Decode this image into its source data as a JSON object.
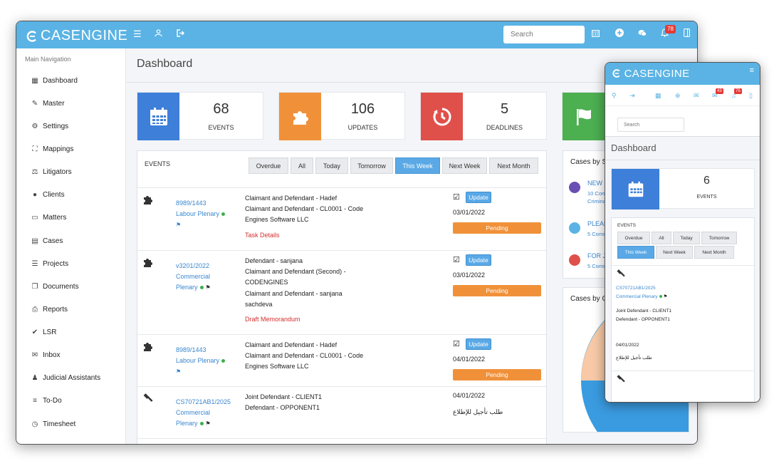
{
  "app": {
    "name": "CASENGINE"
  },
  "topbar": {
    "search_placeholder": "Search",
    "notification_count": "78"
  },
  "sidebar": {
    "heading": "Main Navigation",
    "items": [
      {
        "label": "Dashboard",
        "icon": "dashboard-icon"
      },
      {
        "label": "Master",
        "icon": "edit-icon"
      },
      {
        "label": "Settings",
        "icon": "gears-icon"
      },
      {
        "label": "Mappings",
        "icon": "sitemap-icon"
      },
      {
        "label": "Litigators",
        "icon": "scale-icon"
      },
      {
        "label": "Clients",
        "icon": "user-icon"
      },
      {
        "label": "Matters",
        "icon": "folder-icon"
      },
      {
        "label": "Cases",
        "icon": "file-icon"
      },
      {
        "label": "Projects",
        "icon": "list-icon"
      },
      {
        "label": "Documents",
        "icon": "documents-icon"
      },
      {
        "label": "Reports",
        "icon": "print-icon"
      },
      {
        "label": "LSR",
        "icon": "check-icon"
      },
      {
        "label": "Inbox",
        "icon": "envelope-icon"
      },
      {
        "label": "Judicial Assistants",
        "icon": "users-icon"
      },
      {
        "label": "To-Do",
        "icon": "todo-list-icon"
      },
      {
        "label": "Timesheet",
        "icon": "clock-icon"
      }
    ]
  },
  "main": {
    "title": "Dashboard",
    "stats": [
      {
        "value": "68",
        "label": "EVENTS",
        "color": "#3d7fd9",
        "icon": "calendar-icon"
      },
      {
        "value": "106",
        "label": "UPDATES",
        "color": "#f0913a",
        "icon": "puzzle-icon"
      },
      {
        "value": "5",
        "label": "DEADLINES",
        "color": "#e0504a",
        "icon": "timer-icon"
      },
      {
        "value": "",
        "label": "",
        "color": "#4caf50",
        "icon": "flag-icon"
      }
    ],
    "events": {
      "heading": "EVENTS",
      "filters": [
        "Overdue",
        "All",
        "Today",
        "Tomorrow",
        "This Week",
        "Next Week",
        "Next Month"
      ],
      "active_filter": "This Week",
      "rows": [
        {
          "icon": "puzzle-icon",
          "case_no": "8989/1443",
          "court": "Labour Plenary",
          "lines": [
            "Claimant and Defendant - Hadef",
            "Claimant and Defendant - CL0001 - Code",
            "Engines Software LLC"
          ],
          "task": "Task Details",
          "update_label": "Update",
          "date": "03/01/2022",
          "status": "Pending"
        },
        {
          "icon": "puzzle-icon",
          "case_no": "v3201/2022",
          "court_line1": "Commercial",
          "court_line2": "Plenary",
          "lines": [
            "Defendant - sanjana",
            "Claimant and Defendant (Second) -",
            "CODENGINES",
            "Claimant and Defendant - sanjana",
            "sachdeva"
          ],
          "task": "Draft Memorandum",
          "update_label": "Update",
          "date": "03/01/2022",
          "status": "Pending"
        },
        {
          "icon": "puzzle-icon",
          "case_no": "8989/1443",
          "court": "Labour Plenary",
          "lines": [
            "Claimant and Defendant - Hadef",
            "Claimant and Defendant - CL0001 - Code",
            "Engines Software LLC"
          ],
          "update_label": "Update",
          "date": "04/01/2022",
          "status": "Pending"
        },
        {
          "icon": "gavel-icon",
          "case_no": "CS70721AB1/2025",
          "court_line1": "Commercial",
          "court_line2": "Plenary",
          "lines": [
            "Joint Defendant - CLIENT1",
            "Defendant - OPPONENT1"
          ],
          "date": "04/01/2022",
          "arabic": "طلب تأجيل للإطلاع"
        }
      ]
    },
    "cases_by_status": {
      "title": "Cases by St",
      "items": [
        {
          "name": "NEW C",
          "sub1": "10 Comm",
          "sub2": "Crimina",
          "color": "#6a4fb3"
        },
        {
          "name": "PLEAD",
          "sub1": "5 Comm",
          "color": "#5ab3e4"
        },
        {
          "name": "FOR JU",
          "sub1": "5 Comm",
          "color": "#e0504a"
        }
      ]
    },
    "cases_by_chart": {
      "title": "Cases by Ca"
    }
  },
  "mobile": {
    "app_name": "CASENGINE",
    "badges": [
      "43",
      "75"
    ],
    "search_placeholder": "Search",
    "title": "Dashboard",
    "stat": {
      "value": "6",
      "label": "EVENTS"
    },
    "events_heading": "EVENTS",
    "filters_row1": [
      "Overdue",
      "All",
      "Today",
      "Tomorrow"
    ],
    "filters_row2": [
      "This Week",
      "Next Week",
      "Next Month"
    ],
    "row": {
      "case_no": "CS70721AB1/2025",
      "court": "Commercial Plenary",
      "line1": "Joint Defendant - CLIENT1",
      "line2": "Defendant - OPPONENT1",
      "date": "04/01/2022",
      "arabic": "طلب تأجيل للإطلاع"
    }
  }
}
